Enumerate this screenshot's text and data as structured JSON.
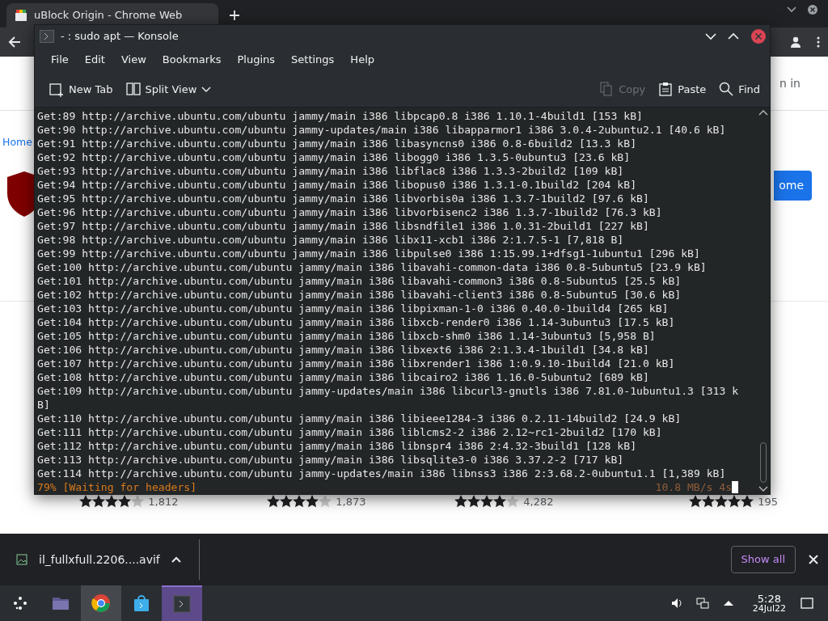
{
  "browser": {
    "tabs": [
      {
        "title": "uBlock Origin - Chrome Web",
        "selected": true
      }
    ],
    "page": {
      "sign_in": "n in",
      "breadcrumb": "Home",
      "add_button": "ome",
      "ratings": [
        {
          "stars": 4,
          "count": "1,812"
        },
        {
          "stars": 4,
          "count": "1,873"
        },
        {
          "stars": 4,
          "count": "4,282"
        },
        {
          "stars": 5,
          "count": "195"
        }
      ]
    }
  },
  "konsole": {
    "title": "- : sudo apt — Konsole",
    "menu": [
      "File",
      "Edit",
      "View",
      "Bookmarks",
      "Plugins",
      "Settings",
      "Help"
    ],
    "toolbar": [
      {
        "label": "New Tab",
        "kind": "newtab",
        "disabled": false
      },
      {
        "label": "Split View",
        "kind": "split",
        "disabled": false
      },
      {
        "label": "Copy",
        "kind": "copy",
        "disabled": true
      },
      {
        "label": "Paste",
        "kind": "paste",
        "disabled": false
      },
      {
        "label": "Find",
        "kind": "find",
        "disabled": false
      }
    ],
    "lines": [
      "Get:89 http://archive.ubuntu.com/ubuntu jammy/main i386 libpcap0.8 i386 1.10.1-4build1 [153 kB]",
      "Get:90 http://archive.ubuntu.com/ubuntu jammy-updates/main i386 libapparmor1 i386 3.0.4-2ubuntu2.1 [40.6 kB]",
      "Get:91 http://archive.ubuntu.com/ubuntu jammy/main i386 libasyncns0 i386 0.8-6build2 [13.3 kB]",
      "Get:92 http://archive.ubuntu.com/ubuntu jammy/main i386 libogg0 i386 1.3.5-0ubuntu3 [23.6 kB]",
      "Get:93 http://archive.ubuntu.com/ubuntu jammy/main i386 libflac8 i386 1.3.3-2build2 [109 kB]",
      "Get:94 http://archive.ubuntu.com/ubuntu jammy/main i386 libopus0 i386 1.3.1-0.1build2 [204 kB]",
      "Get:95 http://archive.ubuntu.com/ubuntu jammy/main i386 libvorbis0a i386 1.3.7-1build2 [97.6 kB]",
      "Get:96 http://archive.ubuntu.com/ubuntu jammy/main i386 libvorbisenc2 i386 1.3.7-1build2 [76.3 kB]",
      "Get:97 http://archive.ubuntu.com/ubuntu jammy/main i386 libsndfile1 i386 1.0.31-2build1 [227 kB]",
      "Get:98 http://archive.ubuntu.com/ubuntu jammy/main i386 libx11-xcb1 i386 2:1.7.5-1 [7,818 B]",
      "Get:99 http://archive.ubuntu.com/ubuntu jammy/main i386 libpulse0 i386 1:15.99.1+dfsg1-1ubuntu1 [296 kB]",
      "Get:100 http://archive.ubuntu.com/ubuntu jammy/main i386 libavahi-common-data i386 0.8-5ubuntu5 [23.9 kB]",
      "Get:101 http://archive.ubuntu.com/ubuntu jammy/main i386 libavahi-common3 i386 0.8-5ubuntu5 [25.5 kB]",
      "Get:102 http://archive.ubuntu.com/ubuntu jammy/main i386 libavahi-client3 i386 0.8-5ubuntu5 [30.6 kB]",
      "Get:103 http://archive.ubuntu.com/ubuntu jammy/main i386 libpixman-1-0 i386 0.40.0-1build4 [265 kB]",
      "Get:104 http://archive.ubuntu.com/ubuntu jammy/main i386 libxcb-render0 i386 1.14-3ubuntu3 [17.5 kB]",
      "Get:105 http://archive.ubuntu.com/ubuntu jammy/main i386 libxcb-shm0 i386 1.14-3ubuntu3 [5,958 B]",
      "Get:106 http://archive.ubuntu.com/ubuntu jammy/main i386 libxext6 i386 2:1.3.4-1build1 [34.8 kB]",
      "Get:107 http://archive.ubuntu.com/ubuntu jammy/main i386 libxrender1 i386 1:0.9.10-1build4 [21.0 kB]",
      "Get:108 http://archive.ubuntu.com/ubuntu jammy/main i386 libcairo2 i386 1.16.0-5ubuntu2 [689 kB]",
      "Get:109 http://archive.ubuntu.com/ubuntu jammy-updates/main i386 libcurl3-gnutls i386 7.81.0-1ubuntu1.3 [313 kB]",
      "Get:110 http://archive.ubuntu.com/ubuntu jammy/main i386 libieee1284-3 i386 0.2.11-14build2 [24.9 kB]",
      "Get:111 http://archive.ubuntu.com/ubuntu jammy/main i386 liblcms2-2 i386 2.12~rc1-2build2 [170 kB]",
      "Get:112 http://archive.ubuntu.com/ubuntu jammy/main i386 libnspr4 i386 2:4.32-3build1 [128 kB]",
      "Get:113 http://archive.ubuntu.com/ubuntu jammy/main i386 libsqlite3-0 i386 3.37.2-2 [717 kB]",
      "Get:114 http://archive.ubuntu.com/ubuntu jammy-updates/main i386 libnss3 i386 2:3.68.2-0ubuntu1.1 [1,389 kB]"
    ],
    "status": {
      "progress": "79% [Waiting for headers]",
      "speed": "10.8 MB/s 4s"
    }
  },
  "downloads": {
    "file": "il_fullxfull.2206....avif",
    "show_all": "Show all"
  },
  "taskbar": {
    "apps": [
      {
        "kind": "launcher",
        "open": false,
        "selected": false
      },
      {
        "kind": "files",
        "open": false,
        "selected": false
      },
      {
        "kind": "browser",
        "open": true,
        "selected": false
      },
      {
        "kind": "store",
        "open": false,
        "selected": false
      },
      {
        "kind": "terminal",
        "open": true,
        "selected": true
      }
    ],
    "time": "5:28",
    "date": "24Jul22"
  }
}
